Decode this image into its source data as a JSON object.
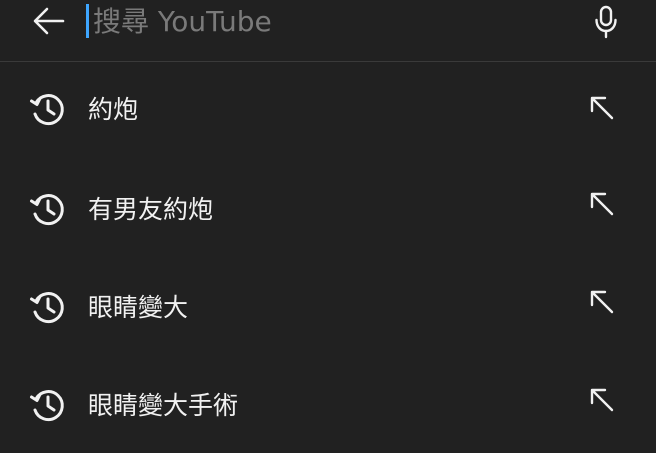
{
  "search": {
    "placeholder": "搜尋 YouTube",
    "value": ""
  },
  "icons": {
    "back": "arrow-left-icon",
    "mic": "microphone-icon",
    "history": "history-icon",
    "fill": "arrow-up-left-icon"
  },
  "colors": {
    "background": "#212121",
    "text": "#f1f1f1",
    "placeholder": "#7a7a7a",
    "caret": "#3ea6ff",
    "divider": "#3a3a3a"
  },
  "suggestions": [
    {
      "text": "約炮"
    },
    {
      "text": "有男友約炮"
    },
    {
      "text": "眼睛變大"
    },
    {
      "text": "眼睛變大手術"
    }
  ]
}
